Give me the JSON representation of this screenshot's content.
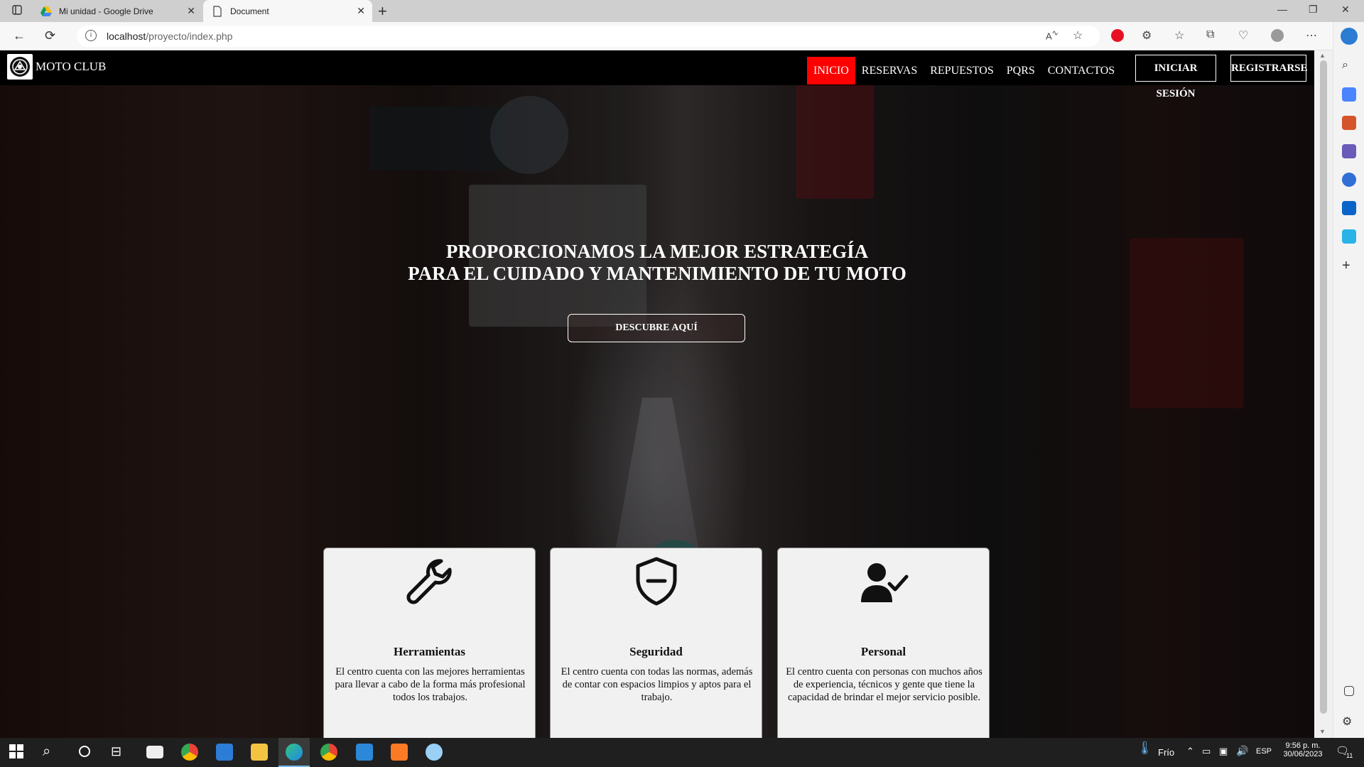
{
  "browser": {
    "tabs": [
      {
        "title": "Mi unidad - Google Drive",
        "active": false
      },
      {
        "title": "Document",
        "active": true
      }
    ],
    "url_host": "localhost",
    "url_path": "/proyecto/index.php"
  },
  "site": {
    "brand": "MOTO CLUB",
    "menu": [
      {
        "label": "INICIO",
        "active": true
      },
      {
        "label": "RESERVAS"
      },
      {
        "label": "REPUESTOS"
      },
      {
        "label": "PQRS"
      },
      {
        "label": "CONTACTOS"
      }
    ],
    "login_label": "INICIAR SESIÓN",
    "register_label": "REGISTRARSE",
    "hero_line1": "PROPORCIONAMOS LA MEJOR ESTRATEGÍA",
    "hero_line2": "PARA EL CUIDADO Y MANTENIMIENTO DE TU MOTO",
    "cta_label": "DESCUBRE AQUÍ",
    "cards": [
      {
        "icon": "wrench-icon",
        "title": "Herramientas",
        "text": "El centro cuenta con las mejores herramientas para llevar a cabo de la forma más profesional todos los trabajos."
      },
      {
        "icon": "shield-icon",
        "title": "Seguridad",
        "text": "El centro cuenta con todas las normas, además de contar con espacios limpios y aptos para el trabajo."
      },
      {
        "icon": "user-check-icon",
        "title": "Personal",
        "text": "El centro cuenta con personas con muchos años de experiencia, técnicos y gente que tiene la capacidad de brindar el mejor servicio posible."
      }
    ]
  },
  "taskbar": {
    "weather": "Frío",
    "lang": "ESP",
    "time": "9:56 p. m.",
    "date": "30/06/2023",
    "notif_count": "11"
  },
  "colors": {
    "accent": "#ff0000",
    "nav_bg": "#000000",
    "card_bg": "#f1f1f1"
  }
}
